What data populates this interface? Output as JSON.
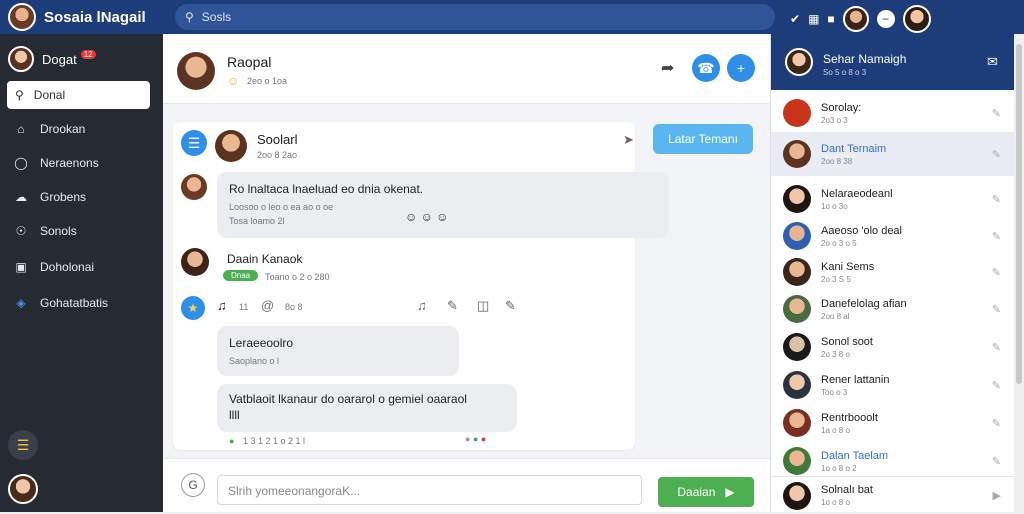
{
  "app": {
    "title": "Sosaia lNagail",
    "search_placeholder": "Sosls"
  },
  "sidebar": {
    "user": {
      "name": "Dogat",
      "badge": "12"
    },
    "search": "Donal",
    "items": [
      {
        "label": "Drookan",
        "icon": "home-icon"
      },
      {
        "label": "Neraenons",
        "icon": "info-icon"
      },
      {
        "label": "Grobens",
        "icon": "cloud-icon"
      },
      {
        "label": "Sonols",
        "icon": "compass-icon"
      },
      {
        "label": "Doholonai",
        "icon": "folder-icon"
      },
      {
        "label": "Gohatatbatis",
        "icon": "apps-icon"
      }
    ]
  },
  "chat": {
    "header": {
      "name": "Raopal",
      "sub": "2eo o 1oa"
    },
    "post": {
      "author": "Soolarl",
      "time": "2oo 8 2ao",
      "follow_label": "Latar Temanı"
    },
    "message1": {
      "text": "Ro lnaltaca lnaeluad eo dnia okenat.",
      "sub": "Loosoo o leo o ea ao o oe",
      "time": "Tosa loamo 2l"
    },
    "message2": {
      "name": "Daain Kanaok",
      "tag": "Dnaa",
      "time": "Toano o 2 o 280"
    },
    "actions": {
      "count": "11",
      "misc": "8o 8"
    },
    "bubble3": {
      "title": "Leraeeoolro",
      "sub": "Saoplano o l"
    },
    "bubble4": {
      "text": "Vatblaoit lkanaur do oararol o gemiel oaaraol",
      "text2": "llll"
    },
    "footer_time": "1 3 1 2 1 o 2 1 l",
    "input_placeholder": "Slrih yomeeonangoraK...",
    "send_label": "Daaian"
  },
  "right": {
    "header": {
      "name": "Sehar Namaigh",
      "sub": "So 5 o 8 o 3"
    },
    "contacts": [
      {
        "name": "Sorolay:",
        "time": "2o3 o 3",
        "highlight": false
      },
      {
        "name": "Dant Ternaim",
        "time": "2oo 8 38",
        "highlight": true
      },
      {
        "name": "Nelaraeodeanl",
        "time": "1o o 3o",
        "highlight": false
      },
      {
        "name": "Aaeoso 'olo deal",
        "time": "2o o 3 o 5",
        "highlight": false
      },
      {
        "name": "Kani Sems",
        "time": "2o 3 S 5",
        "highlight": false
      },
      {
        "name": "Danefelolag afian",
        "time": "2oo 8 al",
        "highlight": false
      },
      {
        "name": "Sonol soot",
        "time": "2o 3 8 o",
        "highlight": false
      },
      {
        "name": "Rener lattanin",
        "time": "Too o 3",
        "highlight": false
      },
      {
        "name": "Rentrbooolt",
        "time": "1a o 8 o",
        "highlight": false
      },
      {
        "name": "Dalan Taelam",
        "time": "1o o 8 o 2",
        "highlight": false
      },
      {
        "name": "Solnalı bat",
        "time": "1o o 8 o",
        "highlight": false
      }
    ]
  },
  "colors": {
    "topbar": "#1d3c7a",
    "sidebar": "#262b33",
    "accent": "#2f8ee8",
    "send": "#4caf50"
  }
}
